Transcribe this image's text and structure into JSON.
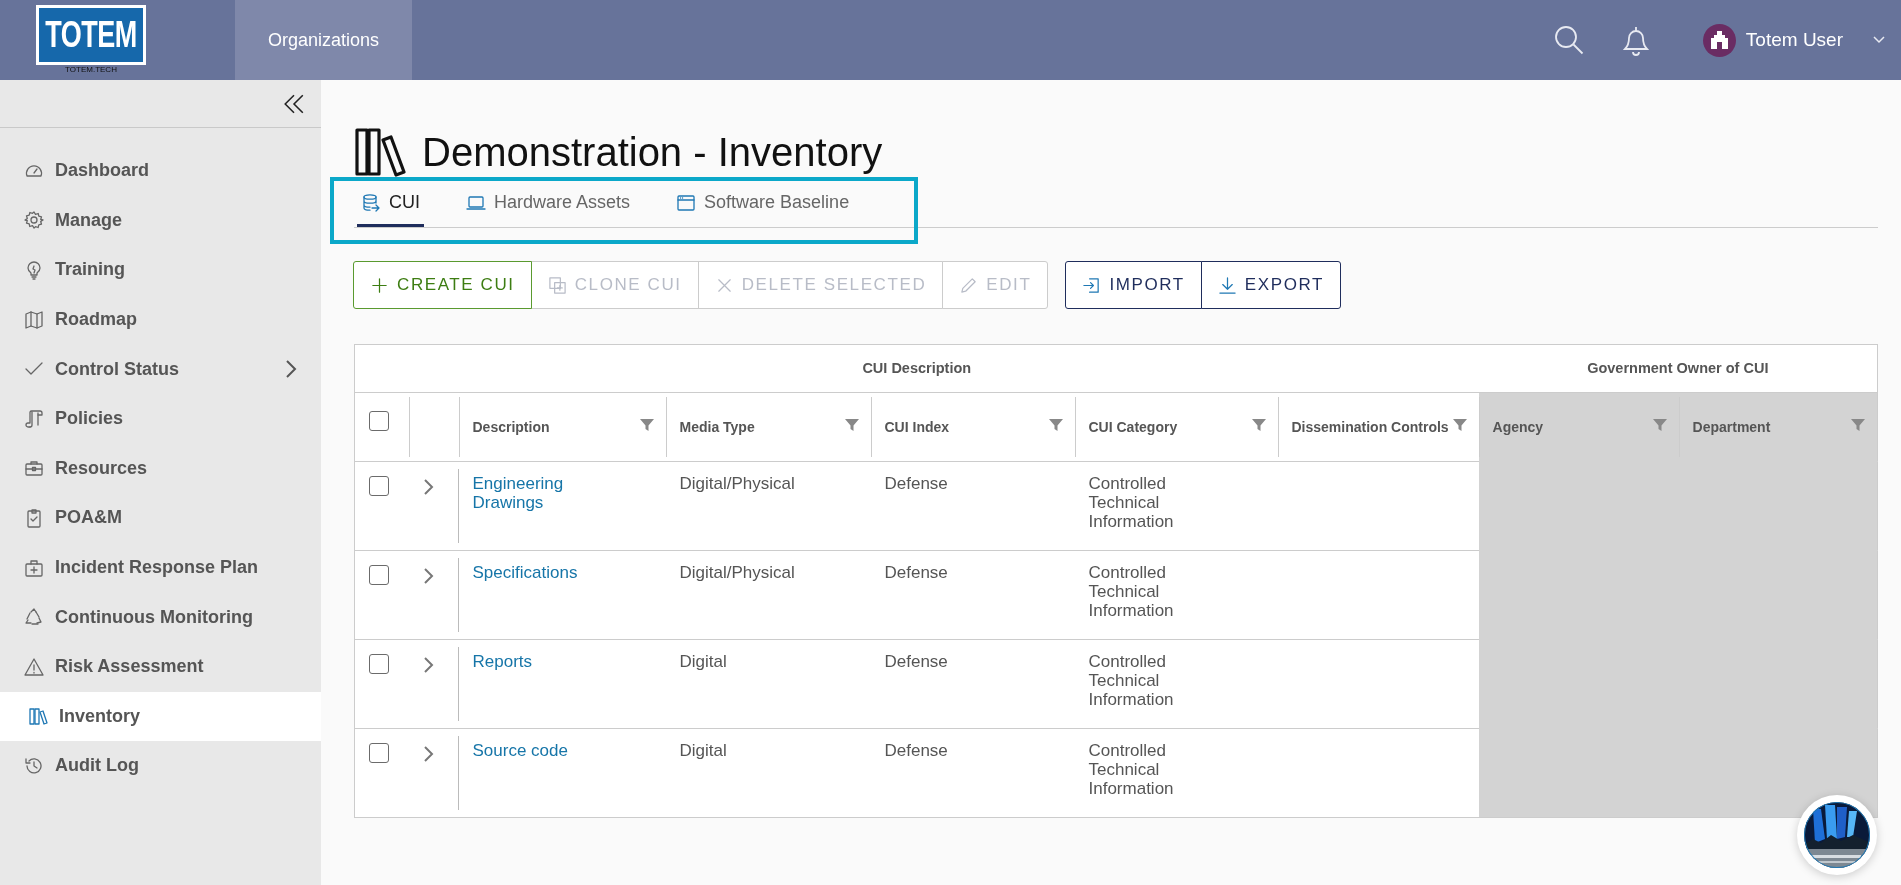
{
  "header": {
    "logo": {
      "text": "TOTEM",
      "tagline": "TOTEM.TECH"
    },
    "nav": [
      {
        "label": "Organizations",
        "selected": true
      }
    ],
    "user": {
      "name": "Totem User"
    }
  },
  "sidebar": {
    "items": [
      {
        "label": "Dashboard",
        "selected": false,
        "has_submenu": false
      },
      {
        "label": "Manage",
        "selected": false,
        "has_submenu": false
      },
      {
        "label": "Training",
        "selected": false,
        "has_submenu": false
      },
      {
        "label": "Roadmap",
        "selected": false,
        "has_submenu": false
      },
      {
        "label": "Control Status",
        "selected": false,
        "has_submenu": true
      },
      {
        "label": "Policies",
        "selected": false,
        "has_submenu": false
      },
      {
        "label": "Resources",
        "selected": false,
        "has_submenu": false
      },
      {
        "label": "POA&M",
        "selected": false,
        "has_submenu": false
      },
      {
        "label": "Incident Response Plan",
        "selected": false,
        "has_submenu": false
      },
      {
        "label": "Continuous Monitoring",
        "selected": false,
        "has_submenu": false
      },
      {
        "label": "Risk Assessment",
        "selected": false,
        "has_submenu": false
      },
      {
        "label": "Inventory",
        "selected": true,
        "has_submenu": false
      },
      {
        "label": "Audit Log",
        "selected": false,
        "has_submenu": false
      }
    ]
  },
  "page": {
    "title": "Demonstration - Inventory"
  },
  "tabs": {
    "highlighted": true,
    "items": [
      {
        "label": "CUI",
        "selected": true
      },
      {
        "label": "Hardware Assets",
        "selected": false
      },
      {
        "label": "Software Baseline",
        "selected": false
      }
    ]
  },
  "toolbar": {
    "groups": [
      {
        "kind": "edit",
        "buttons": [
          {
            "label": "CREATE CUI",
            "disabled": false
          },
          {
            "label": "CLONE CUI",
            "disabled": true
          },
          {
            "label": "DELETE SELECTED",
            "disabled": true
          },
          {
            "label": "EDIT",
            "disabled": true
          }
        ]
      },
      {
        "kind": "transfer",
        "buttons": [
          {
            "label": "IMPORT",
            "disabled": false
          },
          {
            "label": "EXPORT",
            "disabled": false
          }
        ]
      }
    ]
  },
  "table": {
    "select_all": {
      "checked": false
    },
    "column_groups": [
      {
        "label": "CUI Description",
        "columns": [
          {
            "label": "Description",
            "shaded": false
          },
          {
            "label": "Media Type",
            "shaded": false
          },
          {
            "label": "CUI Index",
            "shaded": false
          },
          {
            "label": "CUI Category",
            "shaded": false
          },
          {
            "label": "Dissemination Controls",
            "shaded": false
          }
        ]
      },
      {
        "label": "Government Owner of CUI",
        "columns": [
          {
            "label": "Agency",
            "shaded": true
          },
          {
            "label": "Department",
            "shaded": true
          }
        ]
      }
    ],
    "rows": [
      {
        "checked": false,
        "expanded": false,
        "cells": [
          "Engineering Drawings",
          "Digital/Physical",
          "Defense",
          "Controlled Technical Information"
        ]
      },
      {
        "checked": false,
        "expanded": false,
        "cells": [
          "Specifications",
          "Digital/Physical",
          "Defense",
          "Controlled Technical Information"
        ]
      },
      {
        "checked": false,
        "expanded": false,
        "cells": [
          "Reports",
          "Digital",
          "Defense",
          "Controlled Technical Information"
        ]
      },
      {
        "checked": false,
        "expanded": false,
        "cells": [
          "Source code",
          "Digital",
          "Defense",
          "Controlled Technical Information"
        ]
      }
    ]
  }
}
